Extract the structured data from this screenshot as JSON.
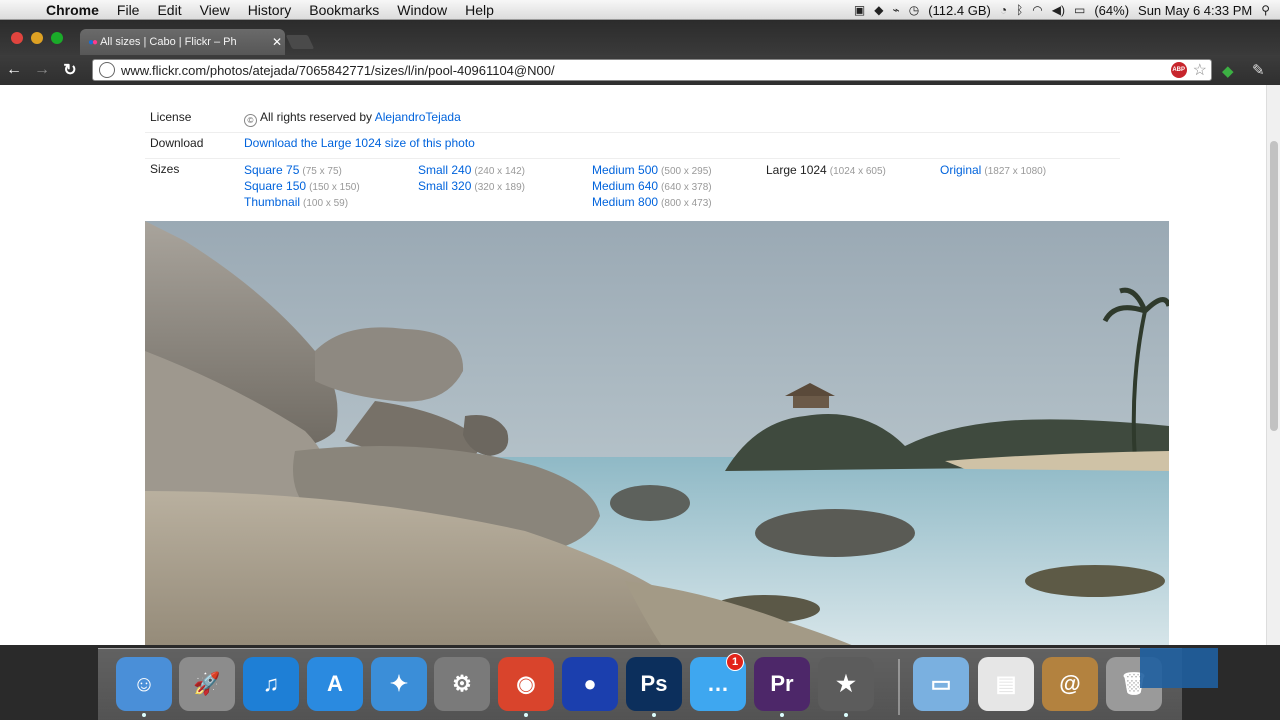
{
  "menubar": {
    "app": "Chrome",
    "items": [
      "File",
      "Edit",
      "View",
      "History",
      "Bookmarks",
      "Window",
      "Help"
    ],
    "disk": "(112.4 GB)",
    "battery": "(64%)",
    "clock": "Sun May 6  4:33 PM"
  },
  "browser": {
    "tab_title": "All sizes | Cabo | Flickr – Ph",
    "url": "www.flickr.com/photos/atejada/7065842771/sizes/l/in/pool-40961104@N00/"
  },
  "page": {
    "license_label": "License",
    "license_text": "All rights reserved by ",
    "license_author": "AlejandroTejada",
    "download_label": "Download",
    "download_link": "Download the Large 1024 size of this photo",
    "sizes_label": "Sizes",
    "sizes": [
      [
        {
          "name": "Square 75",
          "dim": "(75 x 75)"
        },
        {
          "name": "Square 150",
          "dim": "(150 x 150)"
        },
        {
          "name": "Thumbnail",
          "dim": "(100 x 59)"
        }
      ],
      [
        {
          "name": "Small 240",
          "dim": "(240 x 142)"
        },
        {
          "name": "Small 320",
          "dim": "(320 x 189)"
        }
      ],
      [
        {
          "name": "Medium 500",
          "dim": "(500 x 295)"
        },
        {
          "name": "Medium 640",
          "dim": "(640 x 378)"
        },
        {
          "name": "Medium 800",
          "dim": "(800 x 473)"
        }
      ],
      [
        {
          "name": "Large 1024",
          "dim": "(1024 x 605)",
          "current": true
        }
      ],
      [
        {
          "name": "Original",
          "dim": "(1827 x 1080)"
        }
      ]
    ]
  },
  "dock": {
    "items": [
      {
        "name": "finder",
        "glyph": "☺",
        "color": "#4a8fd8"
      },
      {
        "name": "launchpad",
        "glyph": "🚀",
        "color": "#8c8c8c"
      },
      {
        "name": "itunes",
        "glyph": "♫",
        "color": "#1e7fd6"
      },
      {
        "name": "app-store",
        "glyph": "A",
        "color": "#2a8ae0"
      },
      {
        "name": "safari",
        "glyph": "✦",
        "color": "#3b8ed8"
      },
      {
        "name": "system-preferences",
        "glyph": "⚙",
        "color": "#7a7a7a"
      },
      {
        "name": "chrome",
        "glyph": "◉",
        "color": "#d9442c"
      },
      {
        "name": "pokeball-app",
        "glyph": "●",
        "color": "#1b3fae"
      },
      {
        "name": "photoshop",
        "glyph": "Ps",
        "color": "#0c2f5c"
      },
      {
        "name": "messages",
        "glyph": "…",
        "color": "#3ea7f0",
        "badge": "1"
      },
      {
        "name": "premiere",
        "glyph": "Pr",
        "color": "#4d2769"
      },
      {
        "name": "imovie",
        "glyph": "★",
        "color": "#5c5c5c"
      },
      {
        "name": "documents-folder",
        "glyph": "▭",
        "color": "#7ab0e0"
      },
      {
        "name": "preview-doc",
        "glyph": "▤",
        "color": "#e6e6e6"
      },
      {
        "name": "address-book",
        "glyph": "@",
        "color": "#b3823f"
      },
      {
        "name": "trash",
        "glyph": "🗑",
        "color": "#9a9a9a"
      }
    ]
  }
}
